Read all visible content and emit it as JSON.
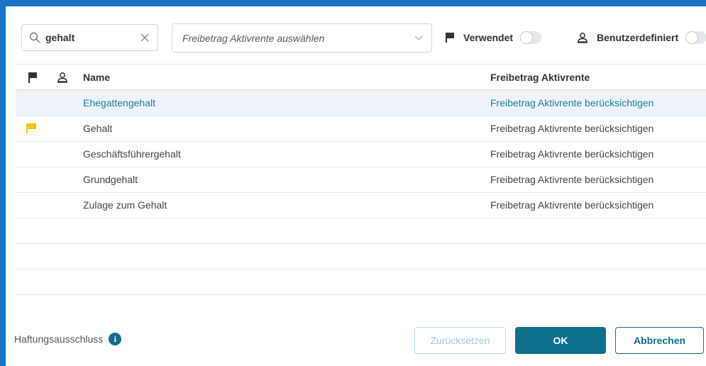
{
  "search": {
    "value": "gehalt"
  },
  "select": {
    "placeholder": "Freibetrag Aktivrente auswählen"
  },
  "filters": {
    "used_label": "Verwendet",
    "custom_label": "Benutzerdefiniert"
  },
  "table": {
    "headers": {
      "name": "Name",
      "freibetrag": "Freibetrag Aktivrente"
    },
    "rows": [
      {
        "name": "Ehegattengehalt",
        "freibetrag": "Freibetrag Aktivrente berücksichtigen",
        "flagged": false,
        "selected": true
      },
      {
        "name": "Gehalt",
        "freibetrag": "Freibetrag Aktivrente berücksichtigen",
        "flagged": true,
        "selected": false
      },
      {
        "name": "Geschäftsführergehalt",
        "freibetrag": "Freibetrag Aktivrente berücksichtigen",
        "flagged": false,
        "selected": false
      },
      {
        "name": "Grundgehalt",
        "freibetrag": "Freibetrag Aktivrente berücksichtigen",
        "flagged": false,
        "selected": false
      },
      {
        "name": "Zulage zum Gehalt",
        "freibetrag": "Freibetrag Aktivrente berücksichtigen",
        "flagged": false,
        "selected": false
      }
    ]
  },
  "footer": {
    "disclaimer": "Haftungsausschluss",
    "info_glyph": "i",
    "reset_label": "Zurücksetzen",
    "ok_label": "OK",
    "cancel_label": "Abbrechen"
  },
  "colors": {
    "accent": "#0e6f8d",
    "selected_row_bg": "#edf3f9",
    "selected_row_text": "#1b7d93",
    "flag_yellow": "#f5c400",
    "frame": "#1a73c7"
  }
}
